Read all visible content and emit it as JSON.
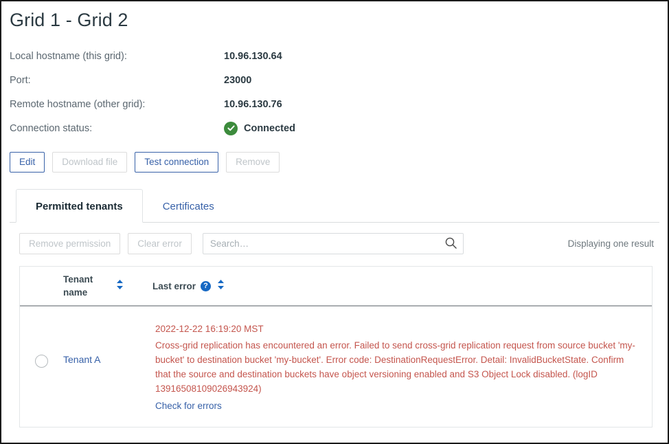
{
  "page": {
    "title": "Grid 1 - Grid 2"
  },
  "details": [
    {
      "label": "Local hostname (this grid):",
      "value": "10.96.130.64"
    },
    {
      "label": "Port:",
      "value": "23000"
    },
    {
      "label": "Remote hostname (other grid):",
      "value": "10.96.130.76"
    }
  ],
  "connection": {
    "label": "Connection status:",
    "value": "Connected",
    "icon": "check-circle-icon",
    "color": "#3c8b3c"
  },
  "actions": [
    {
      "label": "Edit",
      "enabled": true
    },
    {
      "label": "Download file",
      "enabled": false
    },
    {
      "label": "Test connection",
      "enabled": true
    },
    {
      "label": "Remove",
      "enabled": false
    }
  ],
  "tabs": [
    {
      "label": "Permitted tenants",
      "active": true
    },
    {
      "label": "Certificates",
      "active": false
    }
  ],
  "toolbar": {
    "remove_permission_label": "Remove permission",
    "clear_error_label": "Clear error",
    "search_placeholder": "Search…",
    "search_value": "",
    "search_icon": "search-icon",
    "result_count": "Displaying one result"
  },
  "table": {
    "columns": [
      {
        "label": "Tenant name",
        "sortable": true
      },
      {
        "label": "Last error",
        "sortable": true,
        "help": "?"
      }
    ],
    "rows": [
      {
        "tenant_name": "Tenant A",
        "error_time": "2022-12-22 16:19:20 MST",
        "error_message": "Cross-grid replication has encountered an error. Failed to send cross-grid replication request from source bucket 'my-bucket' to destination bucket 'my-bucket'. Error code: DestinationRequestError. Detail: InvalidBucketState. Confirm that the source and destination buckets have object versioning enabled and S3 Object Lock disabled. (logID 13916508109026943924)",
        "error_link": "Check for errors"
      }
    ]
  },
  "colors": {
    "accent": "#3761a8",
    "error": "#c4554d",
    "success": "#3c8b3c",
    "help": "#1668c3"
  }
}
